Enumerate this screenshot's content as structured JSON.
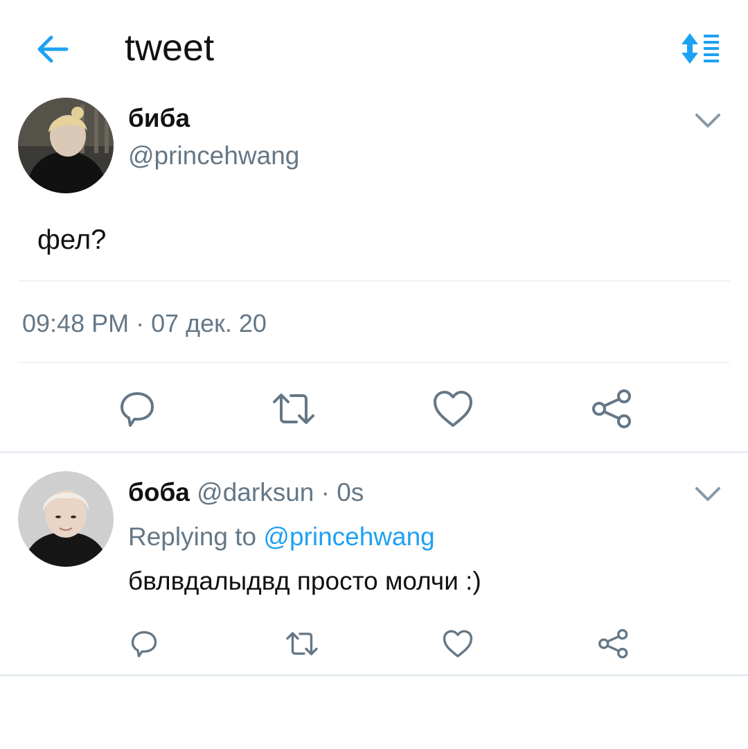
{
  "header": {
    "title": "tweet"
  },
  "tweet": {
    "name": "биба",
    "handle": "@princehwang",
    "text": "фел?",
    "timestamp": "09:48 PM · 07 дек. 20"
  },
  "reply": {
    "name": "боба",
    "handle": "@darksun",
    "age": "· 0s",
    "replying_prefix": "Replying to",
    "replying_handle": "@princehwang",
    "text": "бвлвдалыдвд просто молчи :)"
  },
  "colors": {
    "accent": "#1da1f2",
    "secondary_text": "#657786",
    "icon": "#657786"
  },
  "icons": [
    "back-arrow-icon",
    "sort-icon",
    "chevron-down-icon",
    "reply-icon",
    "retweet-icon",
    "like-icon",
    "share-icon"
  ]
}
